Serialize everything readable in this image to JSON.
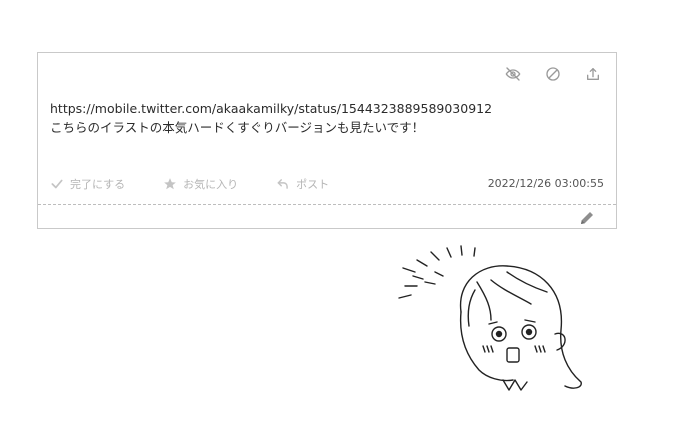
{
  "card": {
    "icons": {
      "hide": "eye-off-icon",
      "block": "block-icon",
      "share": "share-icon",
      "edit": "pencil-icon"
    },
    "message": {
      "line1": "https://mobile.twitter.com/akaakamilky/status/1544323889589030912",
      "line2": "こちらのイラストの本気ハードくすぐりバージョンも見たいです！"
    },
    "actions": {
      "complete": "完了にする",
      "favorite": "お気に入り",
      "post": "ポスト"
    },
    "timestamp": "2022/12/26 03:00:55"
  },
  "colors": {
    "border": "#c9c9c9",
    "icon": "#9a9a9a",
    "muted": "#b5b5b5",
    "text": "#2b2b2b"
  }
}
